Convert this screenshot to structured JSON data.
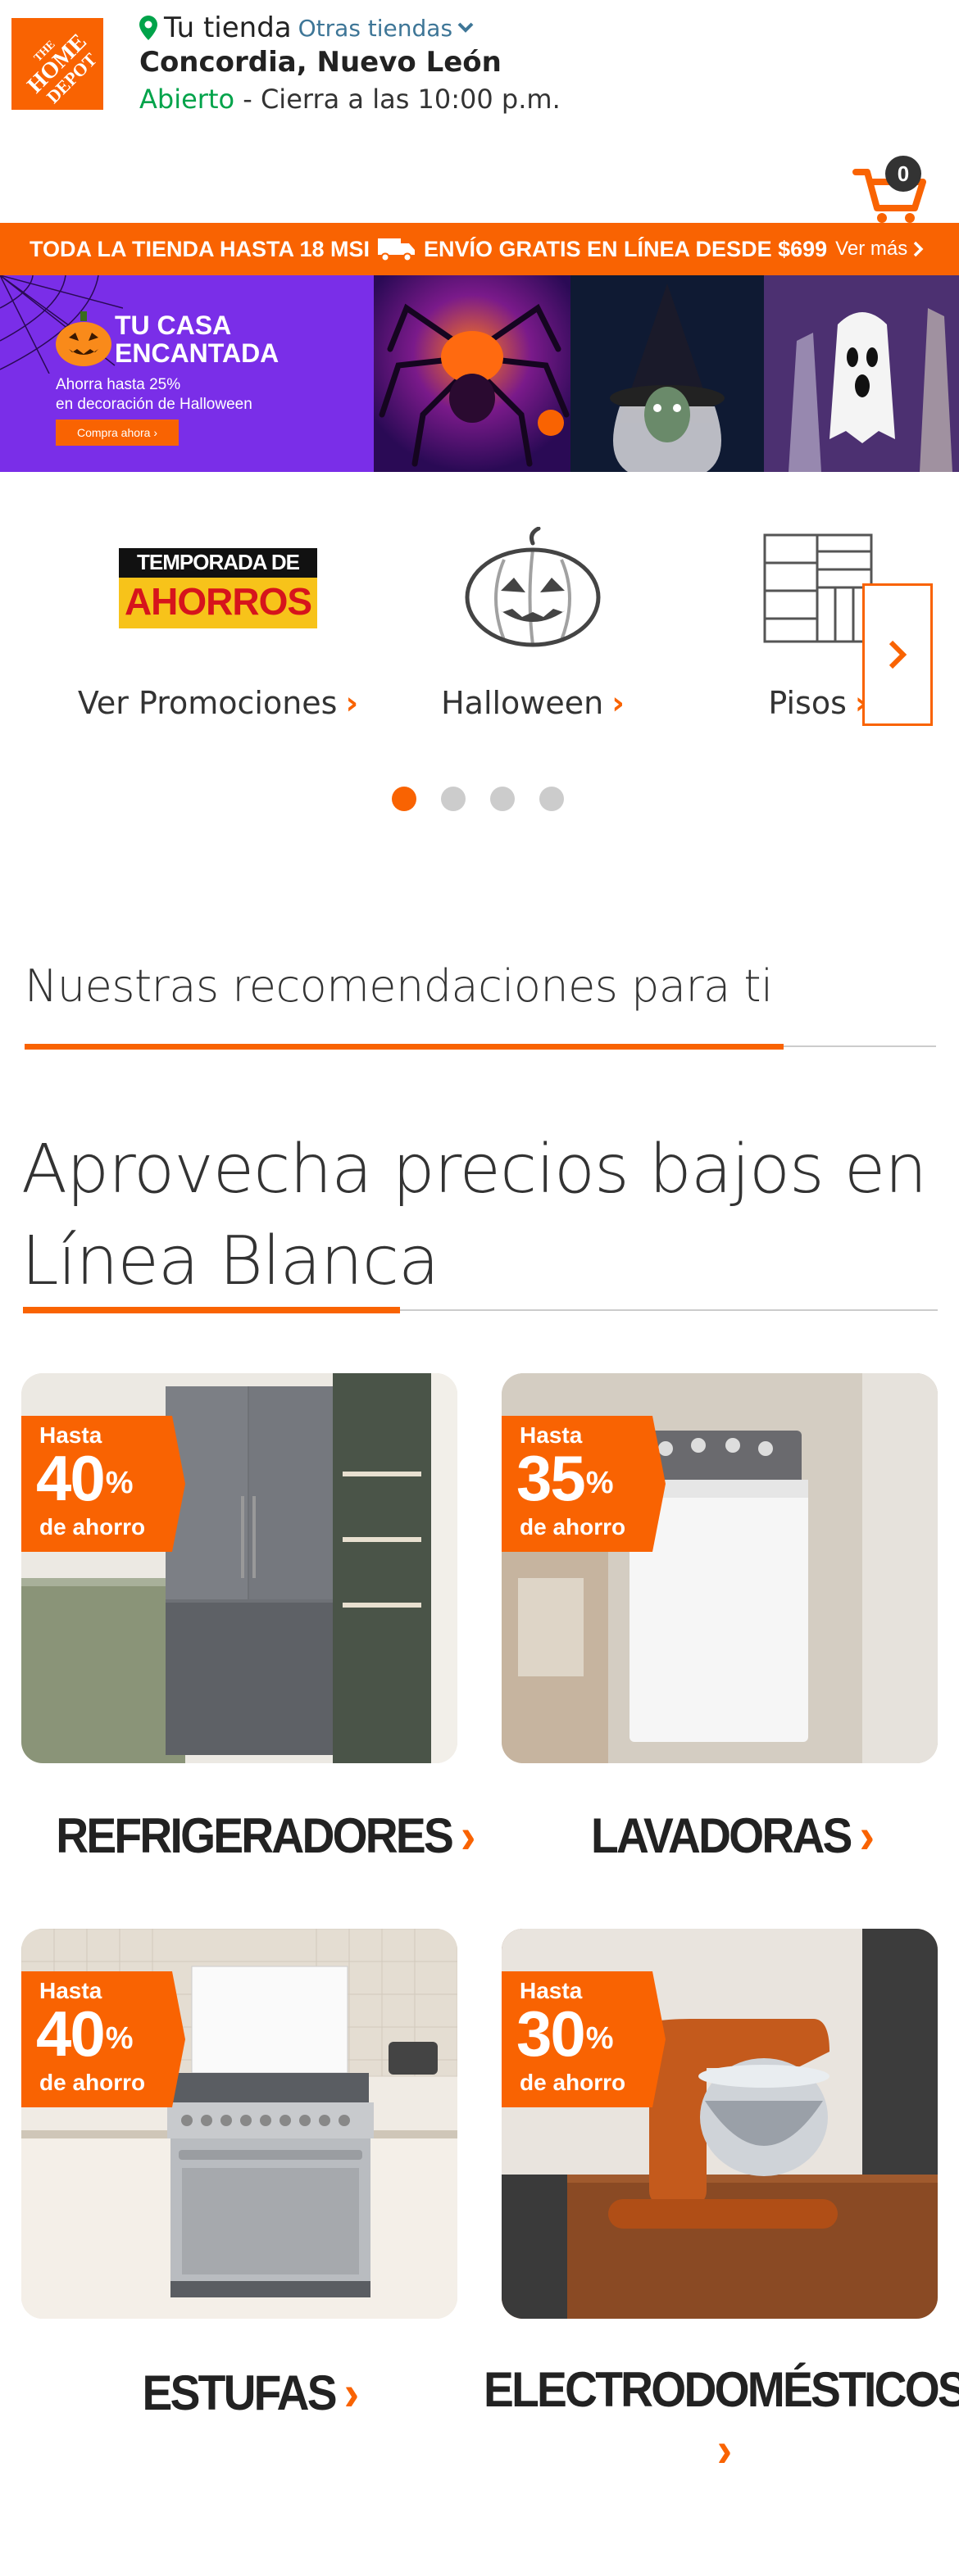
{
  "header": {
    "logo_text": "THE HOME DEPOT",
    "store_label": "Tu tienda",
    "other_stores": "Otras tiendas",
    "store_name": "Concordia, Nuevo León",
    "status_open": "Abierto",
    "status_rest": " - Cierra a las 10:00 p.m.",
    "cart_count": "0",
    "icons": [
      "location-pin-icon",
      "chevron-down-icon",
      "cart-icon"
    ]
  },
  "promo_bar": {
    "text_left": "TODA LA TIENDA HASTA 18 MSI",
    "text_right": "ENVÍO GRATIS EN LÍNEA DESDE $699",
    "more_label": "Ver más",
    "color": "#f96302"
  },
  "hero": {
    "title_line1": "TU CASA",
    "title_line2": "ENCANTADA",
    "sub_line1": "Ahorra hasta 25%",
    "sub_line2": "en decoración de Halloween",
    "button_label": "Compra ahora ›",
    "bg_color": "#7a2ee8"
  },
  "categories": {
    "items": [
      {
        "label": "Ver Promociones",
        "img_line1": "TEMPORADA DE",
        "img_line2": "AHORROS",
        "icon": "temporada-ahorros-logo"
      },
      {
        "label": "Halloween",
        "icon": "pumpkin-icon"
      },
      {
        "label": "Pisos",
        "icon": "floor-tiles-icon"
      }
    ],
    "active_dot": 1,
    "dot_count": 4
  },
  "recommendations": {
    "title": "Nuestras recomendaciones para ti"
  },
  "linea_blanca": {
    "title": "Aprovecha precios bajos en Línea Blanca",
    "products": [
      {
        "badge_top": "Hasta",
        "badge_pct": "40",
        "badge_bottom": "de ahorro",
        "caption": "REFRIGERADORES"
      },
      {
        "badge_top": "Hasta",
        "badge_pct": "35",
        "badge_bottom": "de ahorro",
        "caption": "LAVADORAS"
      },
      {
        "badge_top": "Hasta",
        "badge_pct": "40",
        "badge_bottom": "de ahorro",
        "caption": "ESTUFAS"
      },
      {
        "badge_top": "Hasta",
        "badge_pct": "30",
        "badge_bottom": "de ahorro",
        "caption": "ELECTRODOMÉSTICOS"
      }
    ]
  },
  "colors": {
    "accent": "#f96302",
    "open_green": "#00a34a",
    "link_blue": "#3e7697"
  }
}
